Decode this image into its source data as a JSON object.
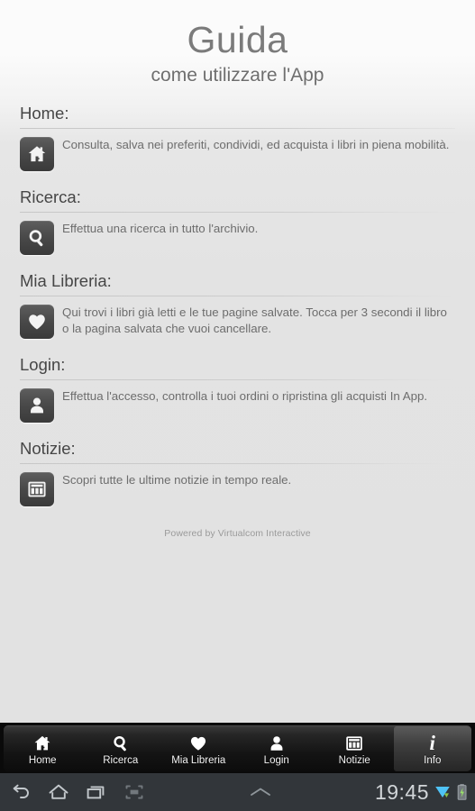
{
  "header": {
    "title": "Guida",
    "subtitle": "come utilizzare l'App"
  },
  "sections": [
    {
      "heading": "Home:",
      "icon": "home-icon",
      "description": "Consulta, salva nei preferiti, condividi, ed acquista i libri in piena mobilità."
    },
    {
      "heading": "Ricerca:",
      "icon": "search-icon",
      "description": "Effettua una ricerca in tutto l'archivio."
    },
    {
      "heading": "Mia Libreria:",
      "icon": "heart-icon",
      "description": "Qui trovi i libri già letti e le tue pagine salvate. Tocca per 3 secondi il libro o la pagina salvata che vuoi cancellare."
    },
    {
      "heading": "Login:",
      "icon": "person-icon",
      "description": "Effettua l'accesso, controlla i tuoi ordini o ripristina gli acquisti In App."
    },
    {
      "heading": "Notizie:",
      "icon": "newspaper-icon",
      "description": "Scopri tutte le ultime notizie in tempo reale."
    }
  ],
  "footer": {
    "credit": "Powered by Virtualcom Interactive"
  },
  "tabbar": {
    "tabs": [
      {
        "label": "Home",
        "icon": "home-icon",
        "selected": false
      },
      {
        "label": "Ricerca",
        "icon": "search-icon",
        "selected": false
      },
      {
        "label": "Mia Libreria",
        "icon": "heart-icon",
        "selected": false
      },
      {
        "label": "Login",
        "icon": "person-icon",
        "selected": false
      },
      {
        "label": "Notizie",
        "icon": "newspaper-icon",
        "selected": false
      },
      {
        "label": "Info",
        "icon": "info-icon",
        "selected": true
      }
    ]
  },
  "system_bar": {
    "back_icon": "back-arrow-icon",
    "home_icon": "home-outline-icon",
    "recents_icon": "recent-apps-icon",
    "screenshot_icon": "screenshot-icon",
    "expand_icon": "chevron-up-icon",
    "clock": "19:45",
    "wifi_icon": "wifi-download-icon",
    "battery_icon": "battery-charging-icon"
  },
  "colors": {
    "page_background": "#e2e2e2",
    "heading_text": "#464646",
    "body_text": "#6d6d6d",
    "title_text": "#7b7b7b",
    "icon_tile": "#4a4a4a",
    "tabbar_background": "#141414",
    "system_bar_background": "#32363a",
    "wifi_accent": "#4fc3f7",
    "download_accent": "#8bc34a"
  }
}
